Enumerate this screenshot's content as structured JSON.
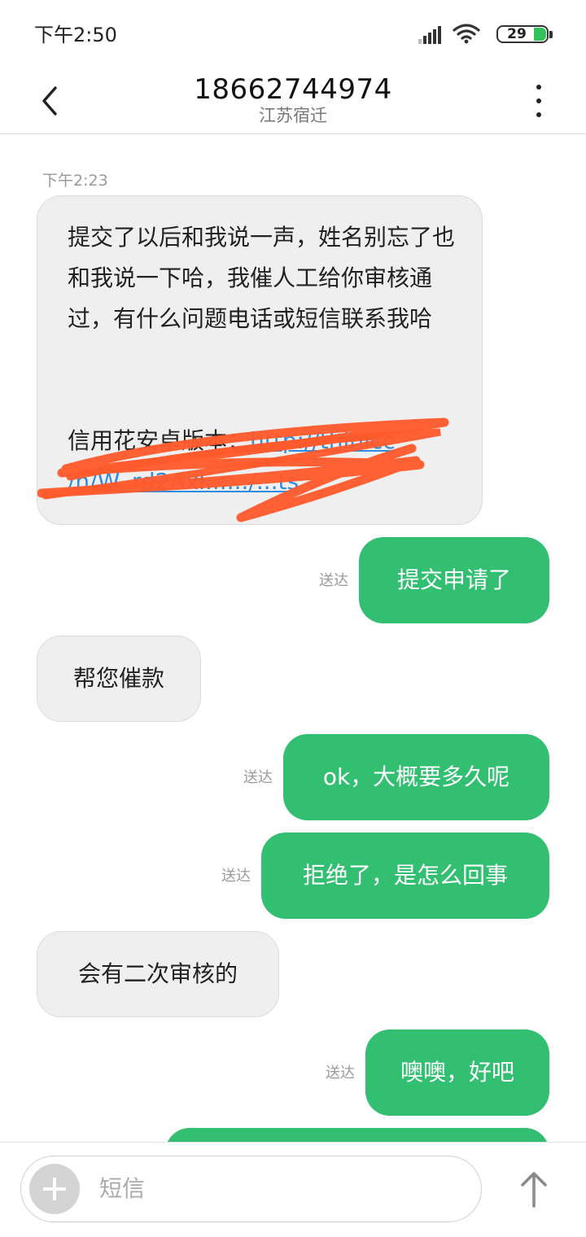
{
  "status_bar": {
    "time": "下午2:50",
    "battery": "29",
    "signal_icon": "signal-icon",
    "wifi_icon": "wifi-icon"
  },
  "header": {
    "title": "18662744974",
    "subtitle": "江苏宿迁",
    "back_icon": "chevron-left-icon",
    "menu_icon": "more-vertical-icon"
  },
  "conversation": {
    "timestamp": "下午2:23",
    "messages": [
      {
        "direction": "incoming",
        "text": "提交了以后和我说一声，姓名别忘了也和我说一下哈，我催人工给你审核通过，有什么问题电话或短信联系我哈",
        "link_label": "信用花安卓版本：",
        "link_text": "http://thinl",
        "link_text_tail": "cc",
        "link_line2": "/h/W..rd2Axl....../...ts",
        "redacted": true
      },
      {
        "direction": "outgoing",
        "status": "送达",
        "text": "提交申请了"
      },
      {
        "direction": "incoming",
        "text": "帮您催款"
      },
      {
        "direction": "outgoing",
        "status": "送达",
        "text": "ok，大概要多久呢"
      },
      {
        "direction": "outgoing",
        "status": "送达",
        "text": "拒绝了，是怎么回事"
      },
      {
        "direction": "incoming",
        "text": "会有二次审核的"
      },
      {
        "direction": "outgoing",
        "status": "送达",
        "text": "噢噢，好吧"
      }
    ]
  },
  "composer": {
    "placeholder": "短信",
    "add_icon": "plus-icon",
    "send_icon": "arrow-up-icon"
  },
  "colors": {
    "outgoing_bubble": "#33bf72",
    "incoming_bubble": "#efefef",
    "link": "#2f8be0",
    "scribble": "#ff5a2c"
  }
}
